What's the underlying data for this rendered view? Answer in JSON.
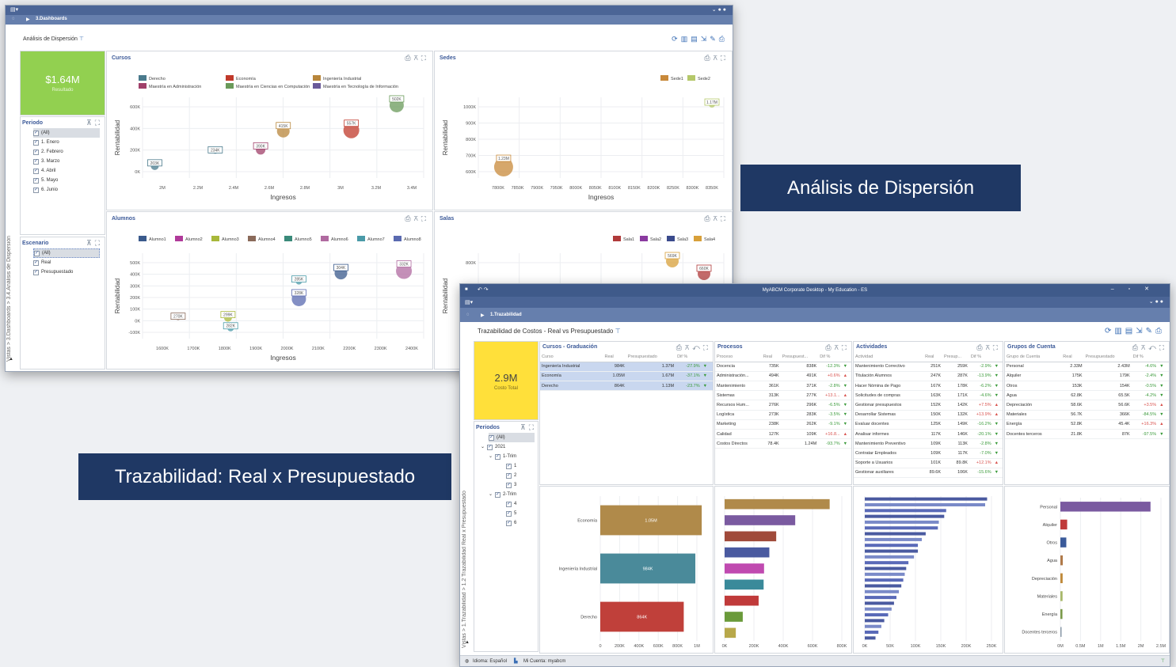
{
  "win1": {
    "breadcrumb": "3.Dashboards",
    "title": "Análisis de Dispersión",
    "side_tab": "Vistas > 3.Dashboards > 3.4.Análisis de Dispersión",
    "kpi": {
      "value": "$1.64M",
      "label": "Resultado"
    },
    "periodo": {
      "title": "Periodo",
      "items": [
        "(All)",
        "1. Enero",
        "2. Febrero",
        "3. Marzo",
        "4. Abril",
        "5. Mayo",
        "6. Junio"
      ]
    },
    "escenario": {
      "title": "Escenario",
      "items": [
        "(All)",
        "Real",
        "Presupuestado"
      ]
    }
  },
  "win2": {
    "title_bar": "MyABCM Corporate Desktop - My Education - ES",
    "breadcrumb": "1.Trazabilidad",
    "title": "Trazabilidad de Costos - Real vs Presupuestado",
    "side_tab": "Vistas > 1.Trazabilidad > 1.2 Trazabilidad Real x Presupuestado",
    "kpi": {
      "value": "2.9M",
      "label": "Costo Total"
    },
    "periodos": {
      "title": "Periodos",
      "items": [
        "(All)",
        "2021",
        "1-Trim",
        "1",
        "2",
        "3",
        "2-Trim",
        "4",
        "5",
        "6"
      ]
    },
    "cursos": {
      "title": "Cursos - Graduación",
      "cols": [
        "Curso",
        "Real",
        "Presupuestado",
        "Dif %"
      ],
      "rows": [
        [
          "Ingeniería Industrial",
          "984K",
          "1.37M",
          "-27.9%"
        ],
        [
          "Economía",
          "1.05M",
          "1.67M",
          "-37.1%"
        ],
        [
          "Derecho",
          "864K",
          "1.13M",
          "-23.7%"
        ]
      ]
    },
    "procesos": {
      "title": "Procesos",
      "cols": [
        "Proceso",
        "Real",
        "Presupuest...",
        "Dif %"
      ],
      "rows": [
        [
          "Docencia",
          "735K",
          "838K",
          "-12.3%"
        ],
        [
          "Administración...",
          "494K",
          "491K",
          "+0.6%"
        ],
        [
          "Mantenimiento",
          "361K",
          "371K",
          "-2.8%"
        ],
        [
          "Sistemas",
          "313K",
          "277K",
          "+13.1..."
        ],
        [
          "Recursos Hum...",
          "276K",
          "296K",
          "-6.5%"
        ],
        [
          "Logística",
          "273K",
          "283K",
          "-3.5%"
        ],
        [
          "Marketing",
          "238K",
          "262K",
          "-9.1%"
        ],
        [
          "Calidad",
          "127K",
          "109K",
          "+16.8..."
        ],
        [
          "Costos Directos",
          "78.4K",
          "1.24M",
          "-93.7%"
        ]
      ]
    },
    "actividades": {
      "title": "Actividades",
      "cols": [
        "Actividad",
        "Real",
        "Presup...",
        "Dif %"
      ],
      "rows": [
        [
          "Mantenimiento Correctivo",
          "251K",
          "259K",
          "-2.9%"
        ],
        [
          "Titulación Alumnos",
          "247K",
          "287K",
          "-13.9%"
        ],
        [
          "Hacer Nómina de Pago",
          "167K",
          "178K",
          "-6.2%"
        ],
        [
          "Solicitudes de compras",
          "163K",
          "171K",
          "-4.6%"
        ],
        [
          "Gestionar presupuestos",
          "152K",
          "142K",
          "+7.5%"
        ],
        [
          "Desarrollar Sistemas",
          "150K",
          "132K",
          "+13.9%"
        ],
        [
          "Evaluar docentes",
          "125K",
          "149K",
          "-16.2%"
        ],
        [
          "Analisar informes",
          "117K",
          "146K",
          "-20.1%"
        ],
        [
          "Mantenimiento Preventivo",
          "109K",
          "113K",
          "-2.8%"
        ],
        [
          "Contratar Empleados",
          "109K",
          "117K",
          "-7.0%"
        ],
        [
          "Soporte a Usuarios",
          "101K",
          "89.8K",
          "+12.1%"
        ],
        [
          "Gestionar auxiliares",
          "89.6K",
          "106K",
          "-15.6%"
        ]
      ]
    },
    "grupos": {
      "title": "Grupos de Cuenta",
      "cols": [
        "Grupo de Cuenta",
        "Real",
        "Presupuestado",
        "Dif %"
      ],
      "rows": [
        [
          "Personal",
          "2.33M",
          "2.43M",
          "-4.6%"
        ],
        [
          "Alquiler",
          "175K",
          "179K",
          "-2.4%"
        ],
        [
          "Otros",
          "153K",
          "154K",
          "-0.5%"
        ],
        [
          "Agua",
          "62.8K",
          "65.5K",
          "-4.2%"
        ],
        [
          "Depreciación",
          "58.6K",
          "56.6K",
          "+3.5%"
        ],
        [
          "Materiales",
          "56.7K",
          "366K",
          "-84.5%"
        ],
        [
          "Energía",
          "52.8K",
          "45.4K",
          "+16.3%"
        ],
        [
          "Docentes terceros",
          "21.8K",
          "87K",
          "-97.5%"
        ]
      ]
    },
    "status": {
      "idioma": "Idioma: Español",
      "cuenta": "Mi Cuenta: myabcm"
    }
  },
  "callouts": {
    "dispersion": "Análisis de Dispersión",
    "trazabilidad": "Trazabilidad: Real x Presupuestado"
  },
  "chart_data": [
    {
      "type": "scatter",
      "title": "Cursos",
      "xlabel": "Ingresos",
      "ylabel": "Rentabilidad",
      "x_ticks": [
        "2M",
        "2.2M",
        "2.4M",
        "2.6M",
        "2.8M",
        "3M",
        "3.2M",
        "3.4M"
      ],
      "y_ticks": [
        "0K",
        "200K",
        "400K",
        "600K"
      ],
      "xlim": [
        1.95,
        3.6
      ],
      "ylim": [
        -100,
        700
      ],
      "legend": [
        "Derecho",
        "Economía",
        "Ingeniería Industrial",
        "Maestría en Administración",
        "Maestría en Ciencias en Computación",
        "Maestría en Tecnología de Información"
      ],
      "colors": [
        "#4a7a8c",
        "#c0392b",
        "#b8863b",
        "#a0406a",
        "#6a9a5a",
        "#6a5a9a"
      ],
      "points": [
        {
          "x": 1.9,
          "y": -30,
          "label": "203K",
          "c": "#4a7a8c",
          "r": 5
        },
        {
          "x": 2.3,
          "y": 150,
          "label": "234K",
          "c": "#4a7a8c",
          "r": 3
        },
        {
          "x": 2.6,
          "y": 170,
          "label": "390K",
          "c": "#a0406a",
          "r": 6
        },
        {
          "x": 2.75,
          "y": 400,
          "label": "415K",
          "c": "#b8863b",
          "r": 8
        },
        {
          "x": 3.2,
          "y": 410,
          "label": "557K",
          "c": "#c0392b",
          "r": 10
        },
        {
          "x": 3.5,
          "y": 720,
          "label": "502K",
          "c": "#6a9a5a",
          "r": 9
        }
      ]
    },
    {
      "type": "scatter",
      "title": "Sedes",
      "xlabel": "Ingresos",
      "ylabel": "Rentabilidad",
      "x_ticks": [
        "7800K",
        "7850K",
        "7900K",
        "7950K",
        "8000K",
        "8050K",
        "8100K",
        "8150K",
        "8200K",
        "8250K",
        "8300K",
        "8350K"
      ],
      "y_ticks": [
        "600K",
        "700K",
        "800K",
        "900K",
        "1000K"
      ],
      "xlim": [
        7775,
        8360
      ],
      "ylim": [
        550,
        1100
      ],
      "legend": [
        "Sede1",
        "Sede2"
      ],
      "colors": [
        "#c8893a",
        "#b5c86a"
      ],
      "points": [
        {
          "x": 7790,
          "y": 590,
          "label": "1.23M",
          "c": "#c8893a",
          "r": 12
        },
        {
          "x": 8360,
          "y": 1120,
          "label": "1.17M",
          "c": "#b5c86a",
          "r": 4
        }
      ]
    },
    {
      "type": "scatter",
      "title": "Alumnos",
      "xlabel": "Ingresos",
      "ylabel": "Rentabilidad",
      "x_ticks": [
        "1600K",
        "1700K",
        "1800K",
        "1900K",
        "2000K",
        "2100K",
        "2200K",
        "2300K",
        "2400K"
      ],
      "y_ticks": [
        "-100K",
        "0K",
        "100K",
        "200K",
        "300K",
        "400K",
        "500K"
      ],
      "xlim": [
        1500,
        2450
      ],
      "ylim": [
        -150,
        520
      ],
      "legend": [
        "Alumno1",
        "Alumno2",
        "Alumno3",
        "Alumno4",
        "Alumno5",
        "Alumno6",
        "Alumno7",
        "Alumno8"
      ],
      "colors": [
        "#3a5a8c",
        "#b03a9a",
        "#a8b83a",
        "#8a6a5a",
        "#3a8a7a",
        "#b06aa0",
        "#4a9aa8",
        "#5a6ab0"
      ],
      "points": [
        {
          "x": 1560,
          "y": -10,
          "label": "270K",
          "c": "#8a6a5a",
          "r": 3
        },
        {
          "x": 1750,
          "y": -10,
          "label": "299K",
          "c": "#a8b83a",
          "r": 5
        },
        {
          "x": 1760,
          "y": -110,
          "label": "282K",
          "c": "#4a9aa8",
          "r": 4
        },
        {
          "x": 2020,
          "y": 340,
          "label": "285K",
          "c": "#4a9aa8",
          "r": 4
        },
        {
          "x": 2020,
          "y": 170,
          "label": "328K",
          "c": "#5a6ab0",
          "r": 9
        },
        {
          "x": 2180,
          "y": 420,
          "label": "304K",
          "c": "#3a5a8c",
          "r": 8
        },
        {
          "x": 2420,
          "y": 440,
          "label": "332K",
          "c": "#b06aa0",
          "r": 10
        }
      ]
    },
    {
      "type": "scatter",
      "title": "Salas",
      "xlabel": "",
      "ylabel": "Rentabilidad",
      "y_ticks": [
        "400K",
        "600K",
        "800K"
      ],
      "legend": [
        "Sala1",
        "Sala2",
        "Sala3",
        "Sala4"
      ],
      "colors": [
        "#b03a3a",
        "#8a3aa0",
        "#3a4a8c",
        "#d8a03a"
      ],
      "points": [
        {
          "label": "569K",
          "c": "#d8a03a"
        },
        {
          "label": "660K",
          "c": "#b03a3a"
        }
      ]
    },
    {
      "type": "bar",
      "orientation": "horizontal",
      "title": "Cursos - Graduación",
      "categories": [
        "Economía",
        "Ingeniería Industrial",
        "Derecho"
      ],
      "values": [
        1.05,
        0.984,
        0.864
      ],
      "labels": [
        "1.05M",
        "984K",
        "864K"
      ],
      "colors": [
        "#b08a4a",
        "#4a8a9a",
        "#c0403a"
      ],
      "x_ticks": [
        "0",
        "200K",
        "400K",
        "600K",
        "800K",
        "1M"
      ],
      "xlim": [
        0,
        1.0
      ]
    },
    {
      "type": "bar",
      "orientation": "horizontal",
      "title": "Procesos",
      "values": [
        735,
        494,
        361,
        313,
        276,
        273,
        238,
        127,
        78.4
      ],
      "colors": [
        "#b08a4a",
        "#7a5aa0",
        "#a04a3a",
        "#4a5aa0",
        "#c04ab0",
        "#3a8a9a",
        "#c03a3a",
        "#6a9a3a",
        "#b8a84a"
      ],
      "x_ticks": [
        "0K",
        "200K",
        "400K",
        "600K",
        "800K"
      ],
      "xlim": [
        0,
        820
      ]
    },
    {
      "type": "bar",
      "orientation": "horizontal",
      "title": "Actividades",
      "values": [
        251,
        247,
        167,
        163,
        152,
        150,
        125,
        117,
        109,
        109,
        101,
        89.6,
        85,
        82,
        79,
        75,
        70,
        65,
        60,
        55,
        48,
        40,
        34,
        28,
        22
      ],
      "x_ticks": [
        "0K",
        "50K",
        "100K",
        "150K",
        "200K",
        "250K"
      ],
      "xlim": [
        0,
        260
      ]
    },
    {
      "type": "bar",
      "orientation": "horizontal",
      "title": "Grupos de Cuenta",
      "categories": [
        "Personal",
        "Alquiler",
        "Otros",
        "Agua",
        "Depreciación",
        "Materiales",
        "Energía",
        "Docentes terceros"
      ],
      "values": [
        2.33,
        0.175,
        0.153,
        0.0628,
        0.0586,
        0.0567,
        0.0528,
        0.0218
      ],
      "colors": [
        "#7a5aa0",
        "#c03a3a",
        "#3a5a9a",
        "#b07a4a",
        "#c08a3a",
        "#a8b86a",
        "#7a9a4a",
        "#8a9aa8"
      ],
      "x_ticks": [
        "0M",
        "0.5M",
        "1M",
        "1.5M",
        "2M",
        "2.5M"
      ],
      "xlim": [
        0,
        2.6
      ]
    }
  ]
}
